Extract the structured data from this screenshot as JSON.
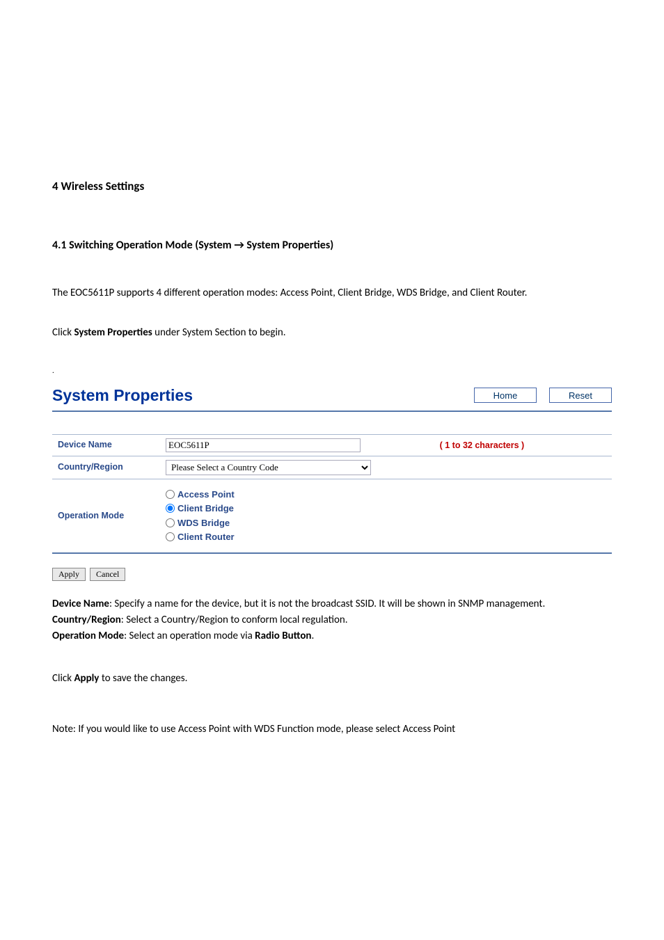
{
  "headings": {
    "section": "4 Wireless Settings",
    "subsection": "4.1 Switching Operation Mode (System → System Properties)"
  },
  "intro": {
    "para1": "The EOC5611P supports 4 different operation modes: Access Point, Client Bridge, WDS Bridge, and Client Router.",
    "para2_prefix": "Click ",
    "para2_bold": "System Properties",
    "para2_suffix": " under System Section to begin."
  },
  "panel": {
    "title": "System Properties",
    "home_label": "Home",
    "reset_label": "Reset"
  },
  "form": {
    "device_name_label": "Device Name",
    "device_name_value": "EOC5611P",
    "device_name_hint": "( 1 to 32 characters )",
    "country_label": "Country/Region",
    "country_value": "Please Select a Country Code",
    "opmode_label": "Operation Mode",
    "opmode_options": {
      "ap": "Access Point",
      "cb": "Client Bridge",
      "wds": "WDS Bridge",
      "cr": "Client Router"
    },
    "opmode_selected": "cb"
  },
  "actions": {
    "apply": "Apply",
    "cancel": "Cancel"
  },
  "definitions": {
    "device_name_term": "Device Name",
    "device_name_desc": ": Specify a name for the device, but it is not the broadcast SSID. It will be shown in SNMP management.",
    "country_term": "Country/Region",
    "country_desc": ": Select a Country/Region to conform local regulation.",
    "opmode_term": "Operation Mode",
    "opmode_desc_prefix": ": Select an operation mode via ",
    "opmode_desc_bold": "Radio Button",
    "opmode_desc_suffix": "."
  },
  "apply_note": {
    "prefix": "Click ",
    "bold": "Apply",
    "suffix": " to save the changes."
  },
  "footer_note": "Note: If you would like to use Access Point with WDS Function mode, please select Access Point"
}
